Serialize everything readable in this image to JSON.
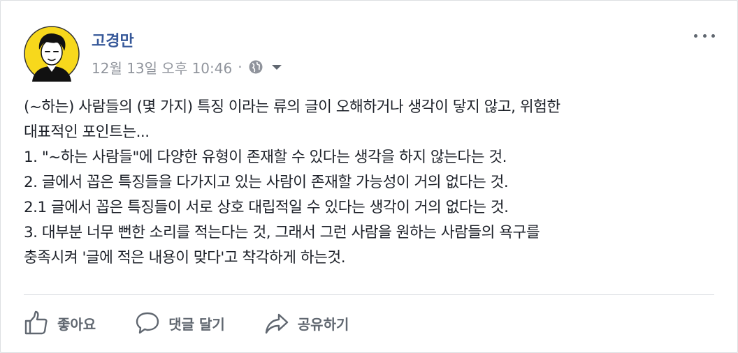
{
  "post": {
    "author": "고경만",
    "timestamp": "12월 13일 오후 10:46",
    "separator": "·",
    "privacy_icon": "globe-icon",
    "more_icon": "more-options-icon",
    "body_lines": [
      "(~하는) 사람들의 (몇 가지) 특징 이라는 류의 글이 오해하거나 생각이 닿지 않고, 위험한",
      "대표적인 포인트는...",
      "1. \"~하는 사람들\"에 다양한 유형이 존재할 수 있다는 생각을 하지 않는다는 것.",
      "2. 글에서 꼽은 특징들을 다가지고 있는 사람이 존재할 가능성이 거의 없다는 것.",
      "2.1 글에서 꼽은 특징들이 서로 상호 대립적일 수 있다는 생각이 거의 없다는 것.",
      "3. 대부분 너무 뻔한 소리를 적는다는 것, 그래서 그런 사람을 원하는 사람들의 욕구를",
      "충족시켜 '글에 적은 내용이 맞다'고 착각하게 하는것."
    ]
  },
  "actions": {
    "like": {
      "label": "좋아요",
      "icon": "thumbs-up-icon"
    },
    "comment": {
      "label": "댓글 달기",
      "icon": "comment-bubble-icon"
    },
    "share": {
      "label": "공유하기",
      "icon": "share-arrow-icon"
    }
  },
  "colors": {
    "author_link": "#365899",
    "meta_gray": "#90949c",
    "body_text": "#1d2129",
    "action_gray": "#606770",
    "avatar_yellow": "#f7d81c"
  }
}
